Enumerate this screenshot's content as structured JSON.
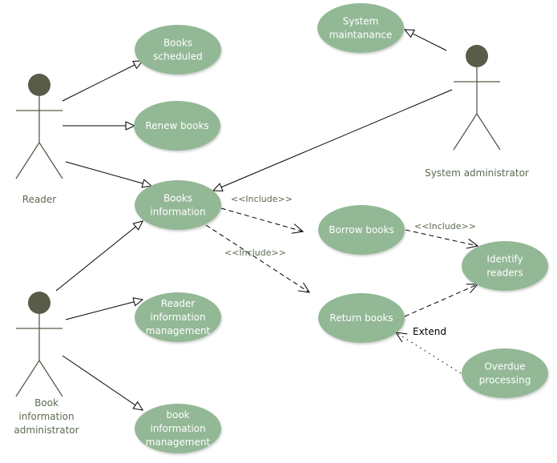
{
  "diagram": {
    "type": "UML use case diagram",
    "colors": {
      "usecase_fill": "#93b896",
      "usecase_text": "#ffffff",
      "actor_head": "#5a5c4a",
      "actor_body": "#5a5c4a",
      "label_text": "#5c6b52",
      "edge": "#000000"
    },
    "actors": [
      {
        "id": "reader",
        "label_lines": [
          "Reader"
        ]
      },
      {
        "id": "sysadmin",
        "label_lines": [
          "System administrator"
        ]
      },
      {
        "id": "bookadmin",
        "label_lines": [
          "Book",
          "information",
          "administrator"
        ]
      }
    ],
    "usecases": [
      {
        "id": "books_scheduled",
        "label_lines": [
          "Books",
          "scheduled"
        ]
      },
      {
        "id": "renew_books",
        "label_lines": [
          "Renew books"
        ]
      },
      {
        "id": "books_information",
        "label_lines": [
          "Books",
          "information"
        ]
      },
      {
        "id": "system_maintenance",
        "label_lines": [
          "System",
          "maintanance"
        ]
      },
      {
        "id": "borrow_books",
        "label_lines": [
          "Borrow books"
        ]
      },
      {
        "id": "return_books",
        "label_lines": [
          "Return books"
        ]
      },
      {
        "id": "identify_readers",
        "label_lines": [
          "Identify",
          "readers"
        ]
      },
      {
        "id": "overdue_processing",
        "label_lines": [
          "Overdue",
          "processing"
        ]
      },
      {
        "id": "reader_info_mgmt",
        "label_lines": [
          "Reader",
          "information",
          "management"
        ]
      },
      {
        "id": "book_info_mgmt",
        "label_lines": [
          "book",
          "information",
          "management"
        ]
      }
    ],
    "relations": [
      {
        "from": "reader",
        "to": "books_scheduled",
        "kind": "association"
      },
      {
        "from": "reader",
        "to": "renew_books",
        "kind": "association"
      },
      {
        "from": "reader",
        "to": "books_information",
        "kind": "association"
      },
      {
        "from": "sysadmin",
        "to": "system_maintenance",
        "kind": "association"
      },
      {
        "from": "sysadmin",
        "to": "books_information",
        "kind": "association"
      },
      {
        "from": "bookadmin",
        "to": "books_information",
        "kind": "association"
      },
      {
        "from": "bookadmin",
        "to": "reader_info_mgmt",
        "kind": "association"
      },
      {
        "from": "bookadmin",
        "to": "book_info_mgmt",
        "kind": "association"
      },
      {
        "from": "books_information",
        "to": "borrow_books",
        "kind": "include",
        "label": "<<Include>>"
      },
      {
        "from": "books_information",
        "to": "return_books",
        "kind": "include",
        "label": "<<Include>>"
      },
      {
        "from": "borrow_books",
        "to": "identify_readers",
        "kind": "include",
        "label": "<<Include>>"
      },
      {
        "from": "return_books",
        "to": "identify_readers",
        "kind": "include",
        "label": ""
      },
      {
        "from": "overdue_processing",
        "to": "return_books",
        "kind": "extend",
        "label": "Extend"
      }
    ]
  }
}
